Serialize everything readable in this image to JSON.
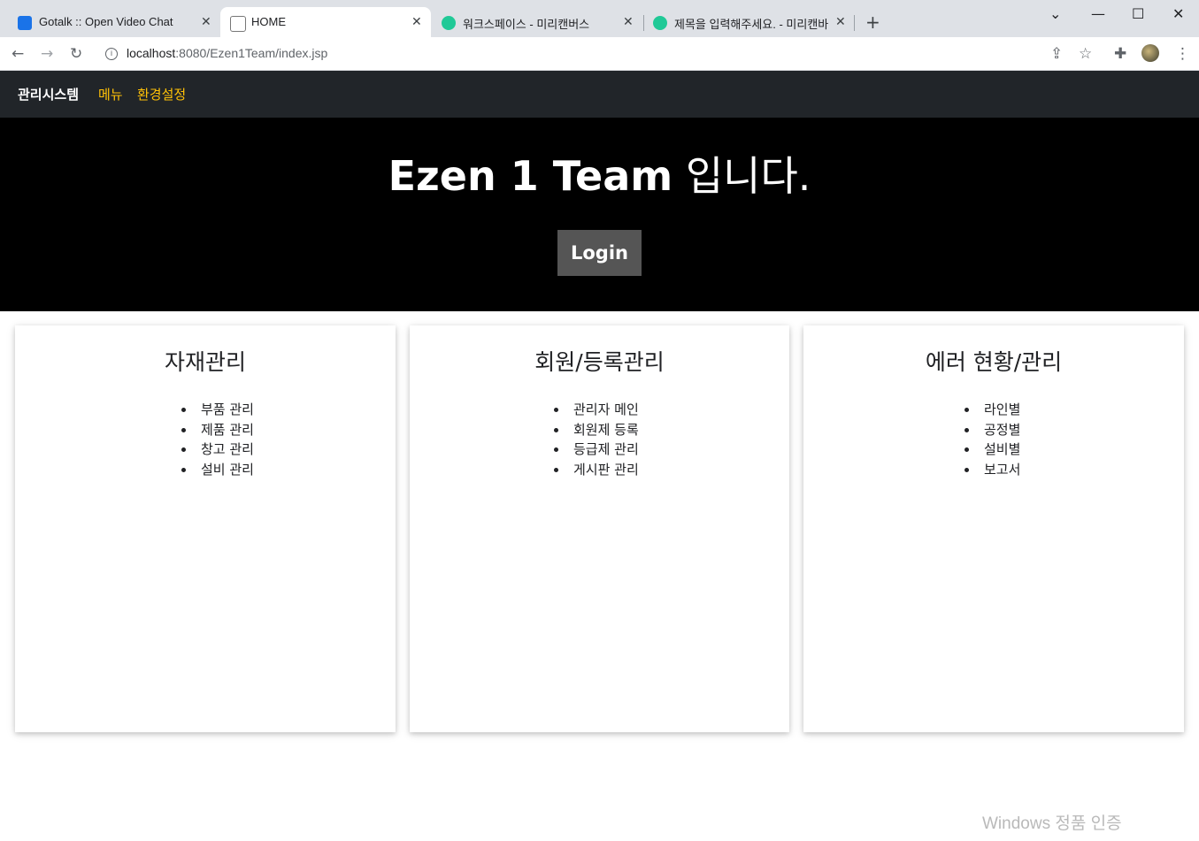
{
  "browser": {
    "tabs": [
      {
        "title": "Gotalk :: Open Video Chat",
        "icon": "gotalk-favicon",
        "active": false
      },
      {
        "title": "HOME",
        "icon": "page-favicon",
        "active": true
      },
      {
        "title": "워크스페이스 - 미리캔버스",
        "icon": "miricanvas-favicon",
        "active": false
      },
      {
        "title": "제목을 입력해주세요. - 미리캔바",
        "icon": "miricanvas-favicon",
        "active": false
      }
    ],
    "url_host": "localhost",
    "url_rest": ":8080/Ezen1Team/index.jsp"
  },
  "navbar": {
    "brand": "관리시스템",
    "links": [
      "메뉴",
      "환경설정"
    ],
    "link_color": "#ffc107"
  },
  "hero": {
    "title_bold": "Ezen 1 Team",
    "title_rest": " 입니다.",
    "login_label": "Login"
  },
  "cards": [
    {
      "title": "자재관리",
      "items": [
        "부품 관리",
        "제품 관리",
        "창고 관리",
        "설비 관리"
      ]
    },
    {
      "title": "회원/등록관리",
      "items": [
        "관리자 메인",
        "회원제 등록",
        "등급제 관리",
        "게시판 관리"
      ]
    },
    {
      "title": "에러 현황/관리",
      "items": [
        "라인별",
        "공정별",
        "설비별",
        "보고서"
      ]
    }
  ],
  "watermark": "Windows 정품 인증"
}
